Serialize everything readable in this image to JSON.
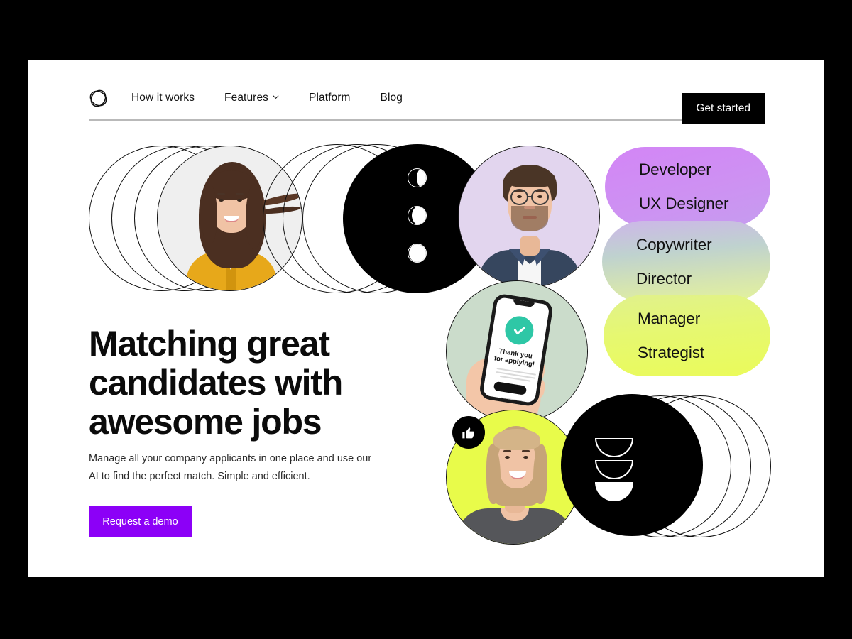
{
  "brand": {
    "logo_icon": "ellipse-slash-logo-icon",
    "accent_purple": "#8C00F7",
    "accent_lime": "#E8FB4A",
    "accent_teal": "#2EC7A6"
  },
  "nav": {
    "links": [
      {
        "label": "How it works",
        "has_chevron": false
      },
      {
        "label": "Features",
        "has_chevron": true,
        "chevron_icon": "chevron-down-icon"
      },
      {
        "label": "Platform",
        "has_chevron": false
      },
      {
        "label": "Blog",
        "has_chevron": false
      }
    ],
    "cta": {
      "label": "Get started"
    }
  },
  "hero": {
    "headline": "Matching great candidates with awesome jobs",
    "subcopy": "Manage all your company applicants in one place and use our AI to find the perfect match. Simple and efficient.",
    "cta": {
      "label": "Request a demo"
    }
  },
  "role_pills": [
    {
      "name": "pill-purple",
      "gradient_from": "#D88BF5",
      "gradient_to": "#C99BF0",
      "roles": [
        "Developer",
        "UX Designer"
      ]
    },
    {
      "name": "pill-sage",
      "gradient_from": "#CDB9E8",
      "gradient_to": "#E3F2A8",
      "roles": [
        "Copywriter",
        "Director"
      ]
    },
    {
      "name": "pill-lime",
      "gradient_from": "#DFF57F",
      "gradient_to": "#E9FB5E",
      "roles": [
        "Manager",
        "Strategist"
      ]
    }
  ],
  "collage": {
    "photo_woman_brunette": {
      "alt": "smiling woman in yellow blouse",
      "bg": "#efefef"
    },
    "photo_man_glasses": {
      "alt": "man with glasses in navy shirt",
      "bg": "#E2D5EE"
    },
    "photo_phone_hand": {
      "alt": "hand holding phone",
      "bg": "#CBDCCB",
      "screen_title": "Thank you",
      "screen_subtitle": "for applying!",
      "check_icon": "check-circle-icon"
    },
    "photo_woman_blonde": {
      "alt": "smiling blonde woman in grey tee",
      "bg": "#E8FB4A"
    },
    "badge": {
      "icon": "thumbs-up-icon"
    },
    "moon_glyphs": {
      "icon": "moon-phase-icon",
      "count": 3
    },
    "bowl_glyphs": {
      "icon": "stacked-semicircle-icon",
      "count": 3
    }
  }
}
